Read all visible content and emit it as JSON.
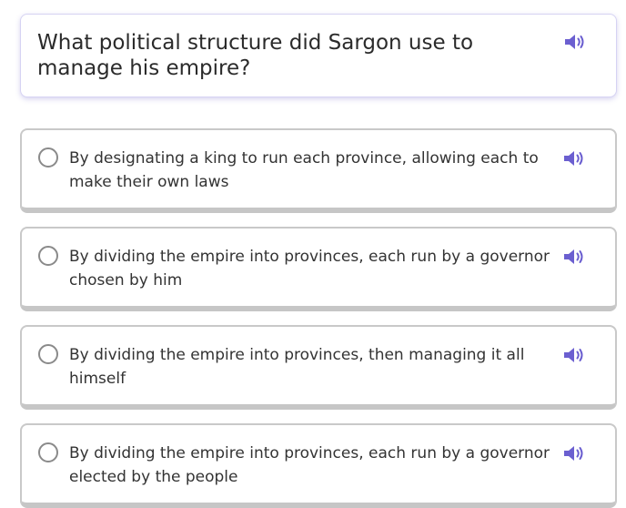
{
  "question": {
    "text": "What political structure did Sargon use to manage his empire?",
    "speaker_icon": "speaker-icon"
  },
  "answers": [
    {
      "text": "By designating a king to run each province, allowing each to make their own laws",
      "selected": false
    },
    {
      "text": "By dividing the empire into provinces, each run by a governor chosen by him",
      "selected": false
    },
    {
      "text": "By dividing the empire into provinces, then managing it all himself",
      "selected": false
    },
    {
      "text": "By dividing the empire into provinces, each run by a governor elected by the people",
      "selected": false
    }
  ],
  "colors": {
    "speaker": "#6b5fd0",
    "card_border": "#d6d3f3",
    "answer_border": "#c9c9c9",
    "radio_border": "#8a8a8a",
    "text": "#333333"
  }
}
